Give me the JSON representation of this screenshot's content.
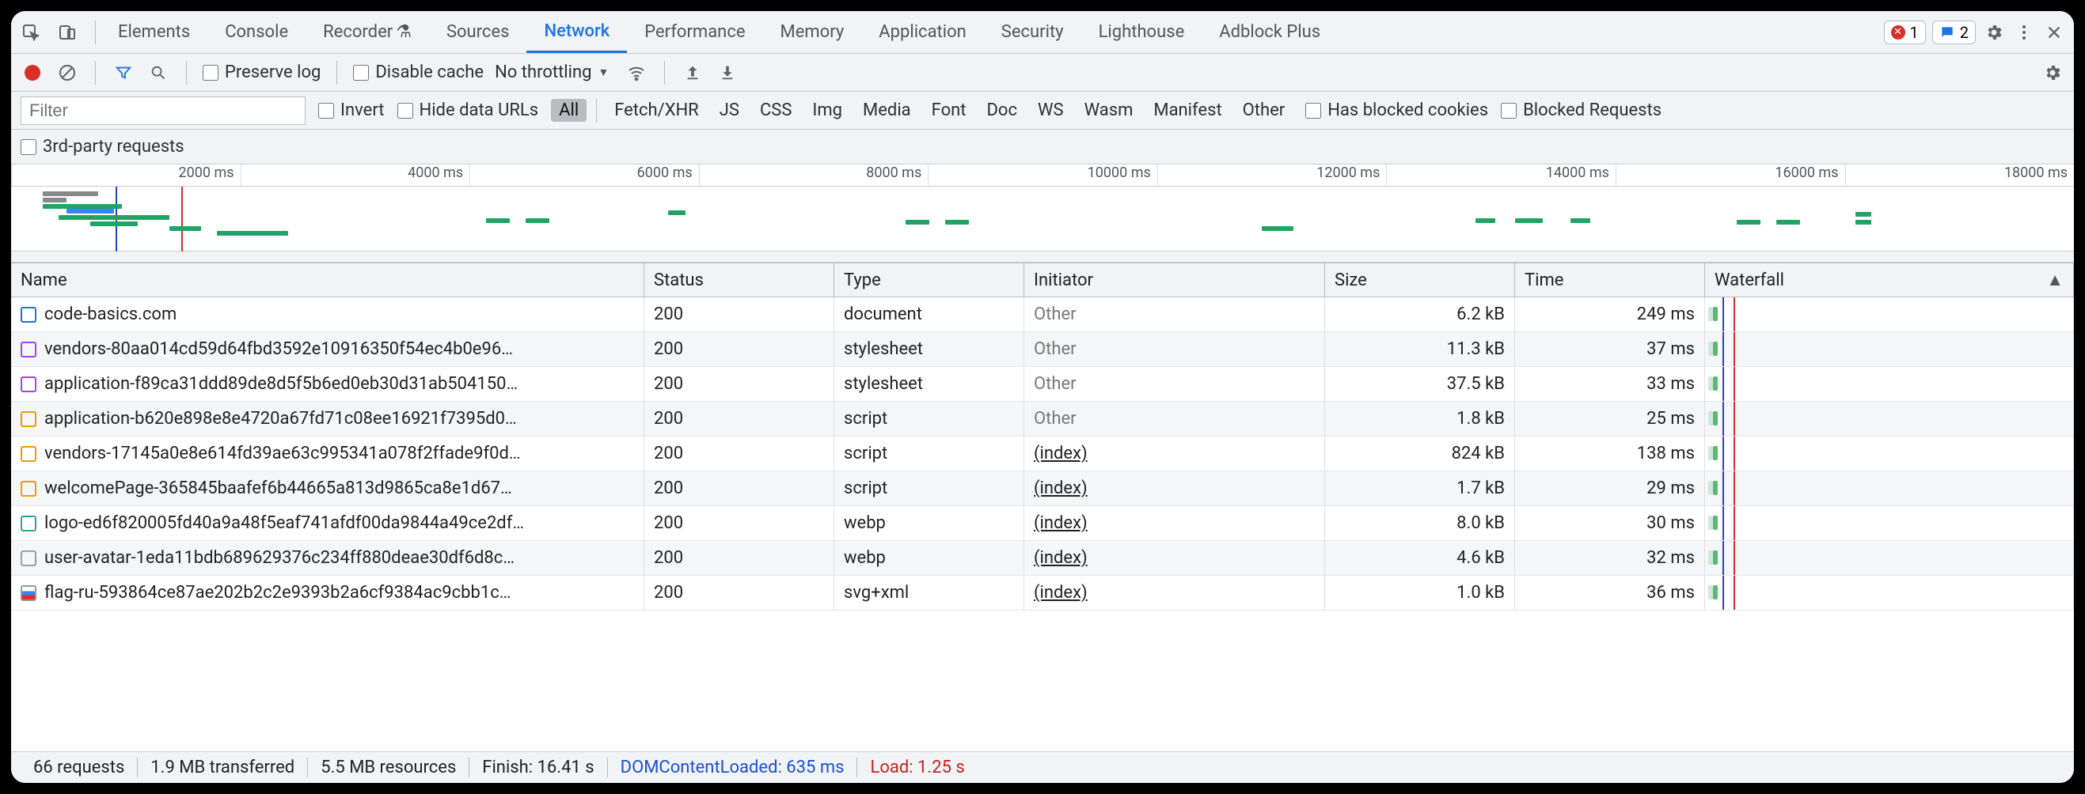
{
  "tabs": {
    "items": [
      "Elements",
      "Console",
      "Recorder",
      "Sources",
      "Network",
      "Performance",
      "Memory",
      "Application",
      "Security",
      "Lighthouse",
      "Adblock Plus"
    ],
    "active": "Network"
  },
  "badges": {
    "errors": "1",
    "messages": "2"
  },
  "toolbar2": {
    "preserve_log": "Preserve log",
    "disable_cache": "Disable cache",
    "throttling": "No throttling"
  },
  "filter": {
    "placeholder": "Filter",
    "invert": "Invert",
    "hide_data_urls": "Hide data URLs",
    "type_filters": [
      "All",
      "Fetch/XHR",
      "JS",
      "CSS",
      "Img",
      "Media",
      "Font",
      "Doc",
      "WS",
      "Wasm",
      "Manifest",
      "Other"
    ],
    "active_type": "All",
    "has_blocked_cookies": "Has blocked cookies",
    "blocked_requests": "Blocked Requests",
    "third_party": "3rd-party requests"
  },
  "timeline_ticks": [
    "2000 ms",
    "4000 ms",
    "6000 ms",
    "8000 ms",
    "10000 ms",
    "12000 ms",
    "14000 ms",
    "16000 ms",
    "18000 ms"
  ],
  "grid": {
    "cols": [
      "Name",
      "Status",
      "Type",
      "Initiator",
      "Size",
      "Time",
      "Waterfall"
    ],
    "rows": [
      {
        "icon": "doc",
        "name": "code-basics.com",
        "status": "200",
        "type": "document",
        "initiator": "Other",
        "initiator_link": false,
        "size": "6.2 kB",
        "time": "249 ms"
      },
      {
        "icon": "css",
        "name": "vendors-80aa014cd59d64fbd3592e10916350f54ec4b0e96…",
        "status": "200",
        "type": "stylesheet",
        "initiator": "Other",
        "initiator_link": false,
        "size": "11.3 kB",
        "time": "37 ms"
      },
      {
        "icon": "css",
        "name": "application-f89ca31ddd89de8d5f5b6ed0eb30d31ab504150…",
        "status": "200",
        "type": "stylesheet",
        "initiator": "Other",
        "initiator_link": false,
        "size": "37.5 kB",
        "time": "33 ms"
      },
      {
        "icon": "js",
        "name": "application-b620e898e8e4720a67fd71c08ee16921f7395d0…",
        "status": "200",
        "type": "script",
        "initiator": "Other",
        "initiator_link": false,
        "size": "1.8 kB",
        "time": "25 ms"
      },
      {
        "icon": "js",
        "name": "vendors-17145a0e8e614fd39ae63c995341a078f2ffade9f0d…",
        "status": "200",
        "type": "script",
        "initiator": "(index)",
        "initiator_link": true,
        "size": "824 kB",
        "time": "138 ms"
      },
      {
        "icon": "js",
        "name": "welcomePage-365845baafef6b44665a813d9865ca8e1d67…",
        "status": "200",
        "type": "script",
        "initiator": "(index)",
        "initiator_link": true,
        "size": "1.7 kB",
        "time": "29 ms"
      },
      {
        "icon": "img",
        "name": "logo-ed6f820005fd40a9a48f5eaf741afdf00da9844a49ce2df…",
        "status": "200",
        "type": "webp",
        "initiator": "(index)",
        "initiator_link": true,
        "size": "8.0 kB",
        "time": "30 ms"
      },
      {
        "icon": "img2",
        "name": "user-avatar-1eda11bdb689629376c234ff880deae30df6d8c…",
        "status": "200",
        "type": "webp",
        "initiator": "(index)",
        "initiator_link": true,
        "size": "4.6 kB",
        "time": "32 ms"
      },
      {
        "icon": "svg",
        "name": "flag-ru-593864ce87ae202b2c2e9393b2a6cf9384ac9cbb1c…",
        "status": "200",
        "type": "svg+xml",
        "initiator": "(index)",
        "initiator_link": true,
        "size": "1.0 kB",
        "time": "36 ms"
      }
    ]
  },
  "status": {
    "requests": "66 requests",
    "transferred": "1.9 MB transferred",
    "resources": "5.5 MB resources",
    "finish": "Finish: 16.41 s",
    "dcl": "DOMContentLoaded: 635 ms",
    "load": "Load: 1.25 s"
  }
}
